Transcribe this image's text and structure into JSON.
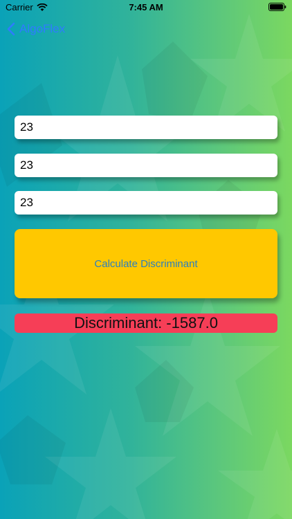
{
  "status_bar": {
    "carrier": "Carrier",
    "time": "7:45 AM"
  },
  "nav": {
    "back_label": "AlgoFlex"
  },
  "inputs": {
    "a": "23",
    "b": "23",
    "c": "23"
  },
  "calculate_button": {
    "label": "Calculate Discriminant"
  },
  "result": {
    "text": "Discriminant: -1587.0"
  },
  "colors": {
    "button": "#ffc800",
    "result_background": "#f63e57",
    "nav_tint": "#2f7bff"
  }
}
